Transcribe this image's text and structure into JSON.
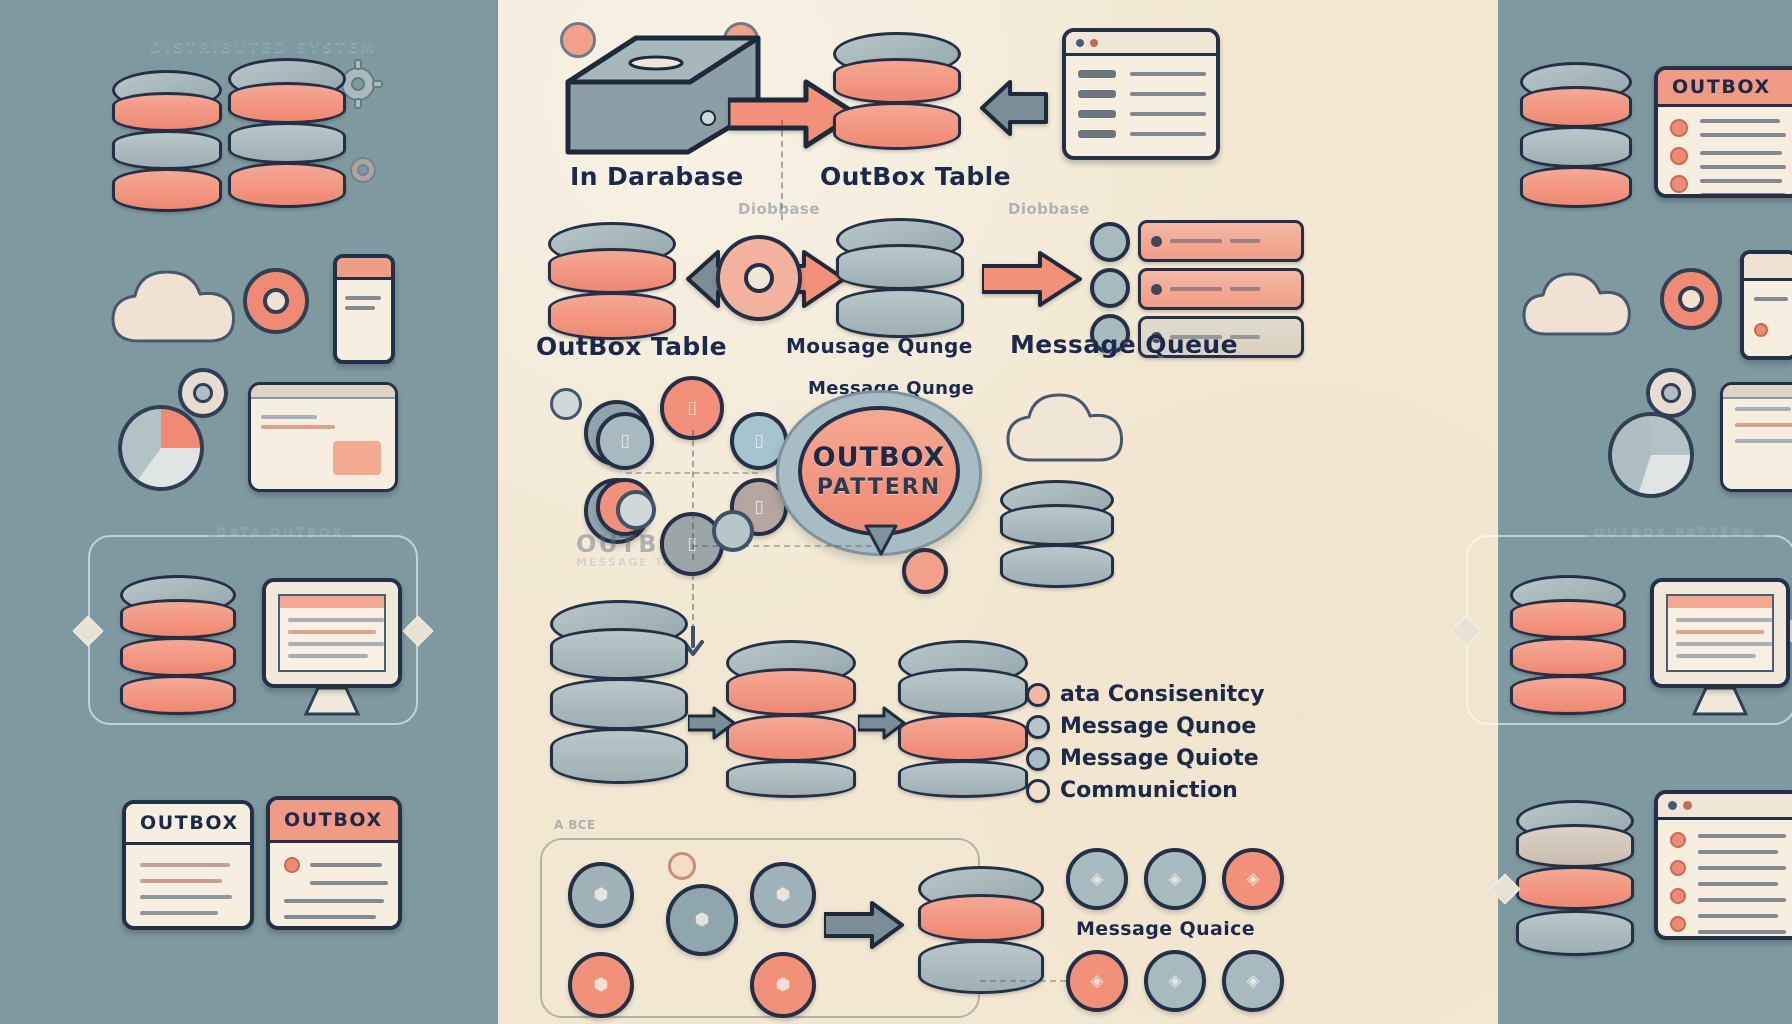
{
  "meta": {
    "background_color": "#7e9aa0",
    "paper_color": "#f2e8d2",
    "ink_color": "#233047",
    "accent_salmon": "#f08a72",
    "accent_steel": "#93a7ab"
  },
  "left_panel": {
    "heading": "DISTRIBUTED SYSTEM",
    "section_caption": "DATA OUTBOX",
    "cards": [
      {
        "title": "OUTBOX",
        "header_color": "#f6efdf"
      },
      {
        "title": "OUTBOX",
        "header_color": "#f08a72"
      }
    ]
  },
  "right_panel": {
    "card_title": "OUTBOX",
    "section_caption": "OUTBOX PATTERN"
  },
  "center": {
    "row1": {
      "node_label": "In Darabase",
      "target_label": "OutBox Table"
    },
    "row2": {
      "left_label": "OutBox Table",
      "mid_label": "Mousage Qunge",
      "right_label": "Message Queue",
      "ghost_label": "Diobbase"
    },
    "row3": {
      "ghost_outbox": "OUTBOX",
      "ghost_sub": "MESSAGE TABLE",
      "queue_label": "Message Qunge",
      "ellipse_title": "OUTBOX",
      "ellipse_subtitle": "PATTERN"
    },
    "legend": {
      "items": [
        {
          "label": "ata Consisenitcy",
          "color": "#f6b79f"
        },
        {
          "label": "Message Qunoe",
          "color": "#b6c6ca"
        },
        {
          "label": "Message Quiote",
          "color": "#a8bcc3"
        },
        {
          "label": "Communiction",
          "color": "#f3ddc5"
        }
      ]
    },
    "bottom": {
      "queue_label": "Message Quaice",
      "ghost_note": "A BCE"
    }
  }
}
